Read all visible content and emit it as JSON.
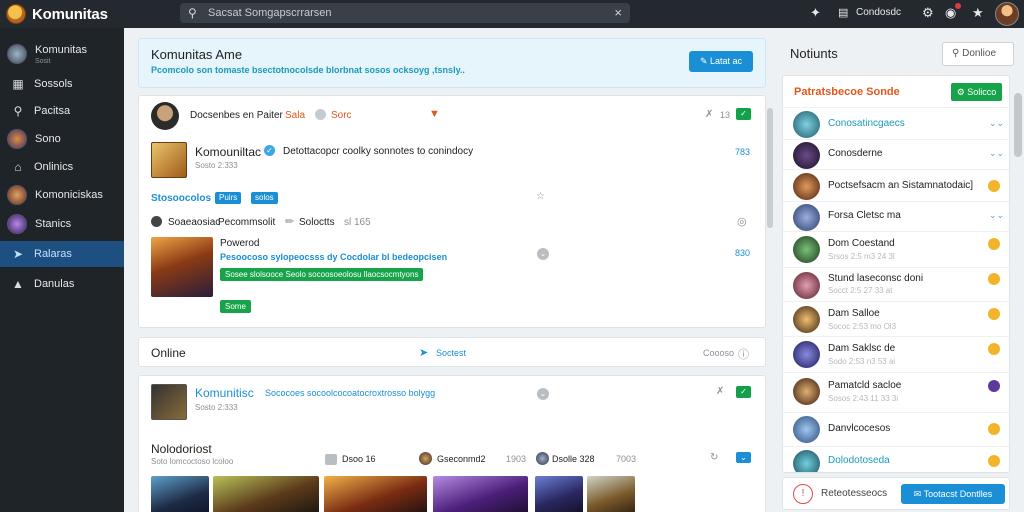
{
  "app": {
    "name": "Komunitas"
  },
  "search": {
    "placeholder": "Sacsat Somgapscrrarsen"
  },
  "topbar": {
    "user_label": "Condosdc"
  },
  "sidebar": {
    "items": [
      {
        "label": "Komunitas",
        "sub": "Sosit"
      },
      {
        "label": "Sossols"
      },
      {
        "label": "Pacitsa"
      },
      {
        "label": "Sono"
      },
      {
        "label": "Onlinics"
      },
      {
        "label": "Komoniciskas"
      },
      {
        "label": "Stanics"
      },
      {
        "label": "Ralaras"
      },
      {
        "label": "Danulas"
      }
    ]
  },
  "hero": {
    "title": "Komunitas Ame",
    "subtitle": "Pcomcolo son tomaste bsectotnocolsde blorbnat sosos ocksoyg ,tsnsly..",
    "button": "Latat ac"
  },
  "post1": {
    "author": "Docsenbes en Paiter",
    "author_tag": "Sala",
    "author_tag2": "Sorc",
    "meta_counter": "13",
    "community_name": "Komouniltac",
    "community_desc": "Detottacopcr coolky sonnotes to conindocy",
    "community_time": "Sosto 2:333",
    "community_stat": "783",
    "tag_label": "Stosoocolos",
    "tag_chip1": "Puirs",
    "tag_chip2": "solos",
    "share_row_a": "Soaeaosiac",
    "share_row_b": "Pecommsolit",
    "share_row_c": "Soloctts",
    "share_row_d": "sl 165",
    "content_title": "Powerod",
    "content_desc": "Pesoocoso sylopeocsss dy Cocdolar bl bedeopcisen",
    "content_bar": "Sosee slolsooce Seolo socoosoeolosu llaocsocmtyons",
    "content_btn": "Some",
    "content_stat": "830"
  },
  "online": {
    "label": "Online",
    "center": "Soctest",
    "right": "Coooso"
  },
  "post2": {
    "community_name": "Komunitisc",
    "community_desc": "Sococoes socoolcocoatocroxtrosso bolygg",
    "community_time": "Sosto 2:333",
    "section_title": "Nolodoriost",
    "section_sub": "Soto lomcoctoso lcoloo",
    "user1": "Dsoo 16",
    "user2": "Gseconmd2",
    "user2_stat": "1903",
    "user3": "Dsolle 328",
    "user3_stat": "7003"
  },
  "right_panel": {
    "title": "Notiunts",
    "select": "Donlioe",
    "head_title": "Patratsbecoe Sonde",
    "head_button": "Solicco",
    "items": [
      {
        "name": "Conosatincgaecs",
        "time": "",
        "blue": true,
        "end": "chevron"
      },
      {
        "name": "Conosderne",
        "time": "",
        "blue": false,
        "end": "chevron"
      },
      {
        "name": "Poctsefsacm an Sistamnatodaic]",
        "time": "",
        "blue": false,
        "end": "emoji"
      },
      {
        "name": "Forsa Cletsc ma",
        "time": "",
        "blue": false,
        "end": "chevron"
      },
      {
        "name": "Dom Coestand",
        "time": "Srsos 2:5 m3 24 3l",
        "blue": false,
        "end": "emoji"
      },
      {
        "name": "Stund laseconsc doni",
        "time": "Socct 2:5 27 33 at",
        "blue": false,
        "end": "emoji"
      },
      {
        "name": "Dam Salloe",
        "time": "Sococ 2:53 mo Ol3",
        "blue": false,
        "end": "emoji"
      },
      {
        "name": "Dam Saklsc de",
        "time": "Sodo 2:53 n3 53 ai",
        "blue": false,
        "end": "emoji"
      },
      {
        "name": "Pamatcld sacloe",
        "time": "Sosos 2:43 11 33 3i",
        "blue": false,
        "end": "purple"
      },
      {
        "name": "Danvlcocesos",
        "time": "",
        "blue": false,
        "end": "emoji"
      },
      {
        "name": "Dolodotoseda",
        "time": "",
        "blue": true,
        "end": "emoji"
      }
    ],
    "footer_text": "Reteotesseocs",
    "footer_button": "Tootacst Dontlles"
  }
}
